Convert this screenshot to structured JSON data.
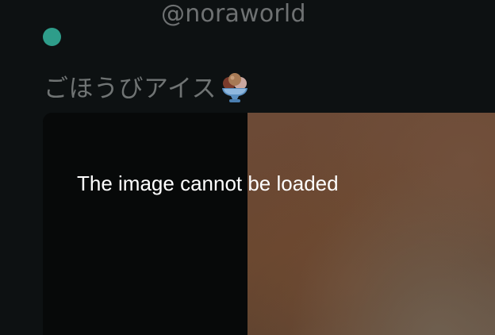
{
  "profile": {
    "username": "@noraworld",
    "status_color": "#2e9d8a"
  },
  "post": {
    "title": "ごほうびアイス",
    "title_icon": "ice-cream-sundae-icon"
  },
  "media": {
    "error_message": "The image cannot be loaded"
  },
  "colors": {
    "background": "#0d1112",
    "muted_text": "#707474",
    "error_text": "#ffffff"
  }
}
